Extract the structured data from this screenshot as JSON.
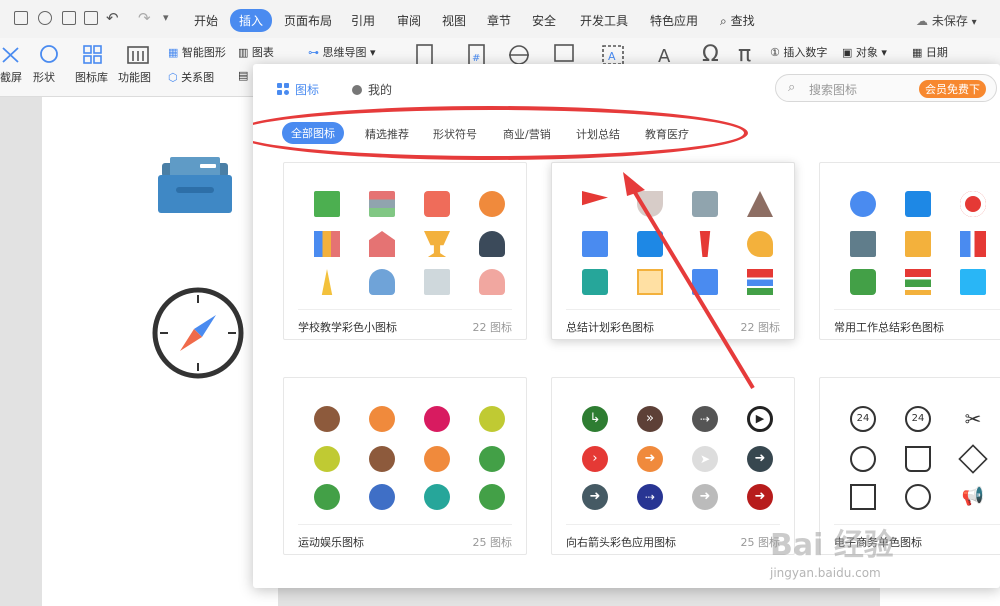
{
  "menubar": {
    "tabs": [
      "开始",
      "插入",
      "页面布局",
      "引用",
      "审阅",
      "视图",
      "章节",
      "安全",
      "开发工具",
      "特色应用"
    ],
    "active_tab": "插入",
    "search_label": "查找",
    "unsaved_label": "未保存"
  },
  "ribbon": {
    "smart_shape": "智能图形",
    "chart": "图表",
    "mindmap": "思维导图",
    "relationship": "关系图",
    "shape": "形状",
    "screenshot": "截屏",
    "icon_library": "图标库",
    "function_chart": "功能图",
    "insert_number": "插入数字",
    "object": "对象",
    "date": "日期"
  },
  "panel": {
    "tab_icons": "图标",
    "tab_mine": "我的",
    "search_placeholder": "搜索图标",
    "vip_badge": "会员免费下",
    "categories": [
      "全部图标",
      "精选推荐",
      "形状符号",
      "商业/营销",
      "计划总结",
      "教育医疗"
    ],
    "active_category": "全部图标",
    "cards": [
      {
        "title": "学校教学彩色小图标",
        "count": "22 图标"
      },
      {
        "title": "总结计划彩色图标",
        "count": "22 图标"
      },
      {
        "title": "常用工作总结彩色图标",
        "count": ""
      },
      {
        "title": "运动娱乐图标",
        "count": "25 图标"
      },
      {
        "title": "向右箭头彩色应用图标",
        "count": "25 图标"
      },
      {
        "title": "电子商务单色图标",
        "count": ""
      }
    ]
  },
  "watermark": {
    "text": "Bai 经验",
    "sub": "jingyan.baidu.com"
  },
  "colors": {
    "accent": "#4a8bf0",
    "highlight": "#e63b3b",
    "vip": "#f7882f"
  }
}
